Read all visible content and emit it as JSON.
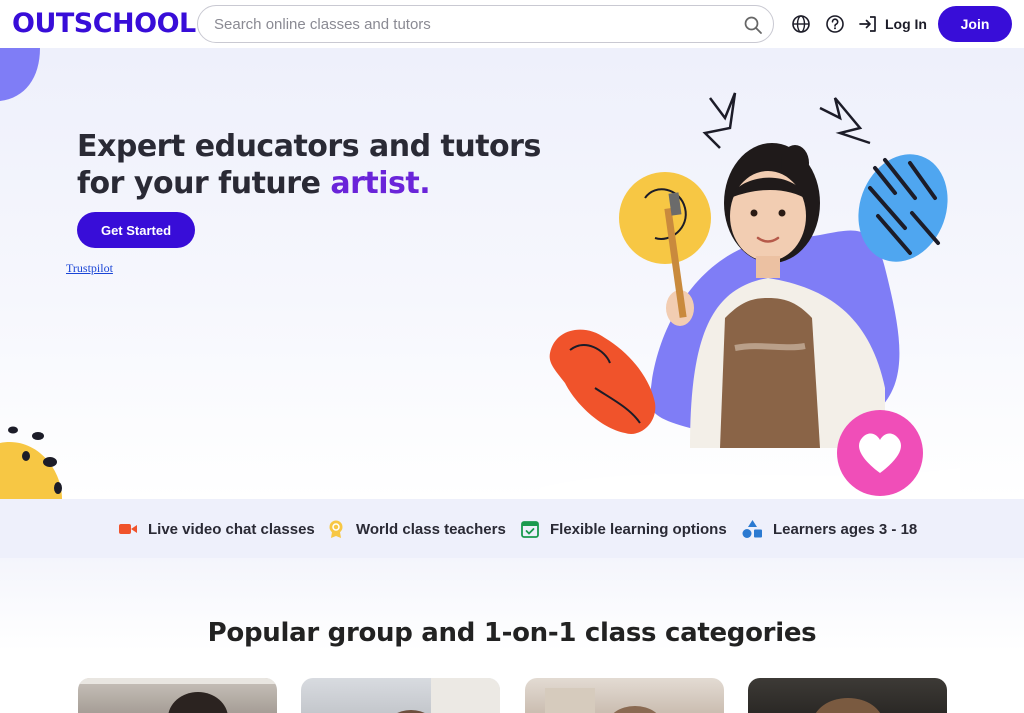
{
  "header": {
    "logo": "OUTSCHOOL",
    "search_placeholder": "Search online classes and tutors",
    "login_label": "Log In",
    "join_label": "Join"
  },
  "hero": {
    "title_line1": "Expert educators and tutors",
    "title_line2_prefix": "for your future ",
    "title_accent": "artist.",
    "cta_label": "Get Started",
    "trustpilot_link": "Trustpilot"
  },
  "features": [
    {
      "label": "Live video chat classes",
      "icon": "video-camera-icon",
      "color": "#f0532b"
    },
    {
      "label": "World class teachers",
      "icon": "award-ribbon-icon",
      "color": "#f7c744"
    },
    {
      "label": "Flexible learning options",
      "icon": "calendar-check-icon",
      "color": "#1a9a4e"
    },
    {
      "label": "Learners ages 3 - 18",
      "icon": "shapes-icon",
      "color": "#2b7ad1"
    }
  ],
  "categories": {
    "title": "Popular group and 1-on-1 class categories"
  },
  "colors": {
    "brand": "#380dd8",
    "accent_text": "#6a24d9",
    "heart_pink": "#f04eb8"
  }
}
